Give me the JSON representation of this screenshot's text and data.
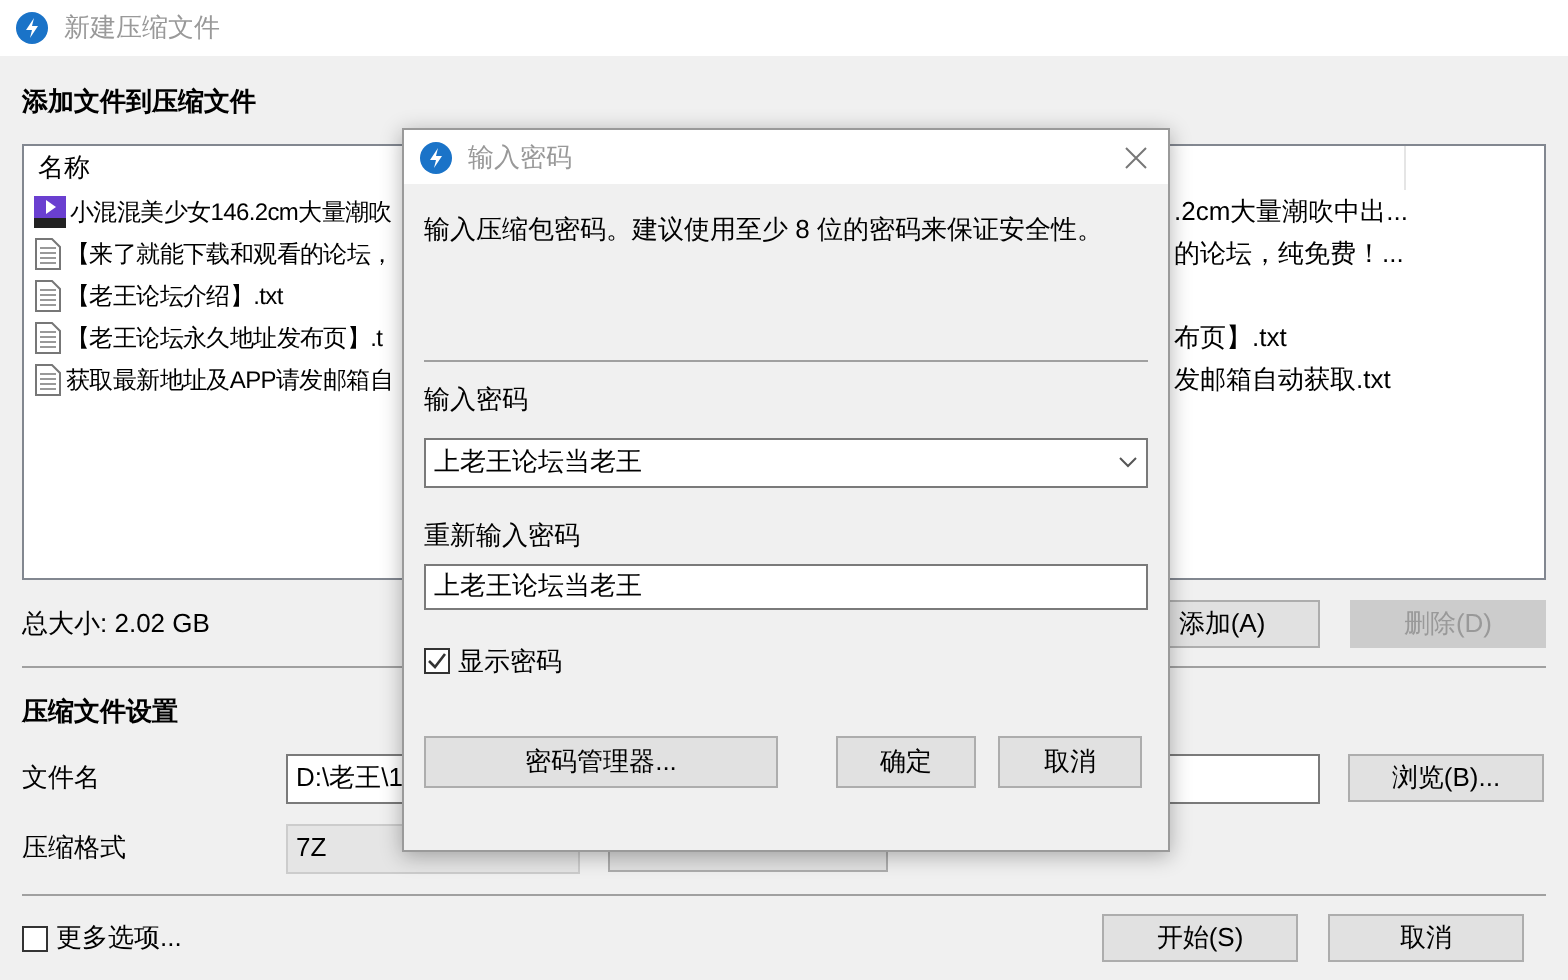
{
  "window": {
    "title": "新建压缩文件"
  },
  "add_section": {
    "heading": "添加文件到压缩文件",
    "column": "名称",
    "files": [
      {
        "kind": "video",
        "left": "小混混美少女146.2cm大量潮吹",
        "right": ".2cm大量潮吹中出..."
      },
      {
        "kind": "text",
        "left": "【来了就能下载和观看的论坛，",
        "right": "的论坛，纯免费！..."
      },
      {
        "kind": "text",
        "left": "【老王论坛介绍】.txt"
      },
      {
        "kind": "text",
        "left": "【老王论坛永久地址发布页】.t",
        "right": "布页】.txt"
      },
      {
        "kind": "text",
        "left": "获取最新地址及APP请发邮箱自",
        "right": "发邮箱自动获取.txt"
      }
    ],
    "total": "总大小: 2.02 GB",
    "buttons": [
      {
        "label": "添加(A)",
        "disabled": false
      },
      {
        "label": "删除(D)",
        "disabled": true
      }
    ]
  },
  "settings": {
    "heading": "压缩文件设置",
    "filename_label": "文件名",
    "filename_value": "D:\\老王\\1",
    "browse": "浏览(B)...",
    "format_label": "压缩格式",
    "format_value": "7Z"
  },
  "more_options": {
    "label": "更多选项...",
    "checked": false
  },
  "footer_buttons": [
    "开始(S)",
    "取消"
  ],
  "dialog": {
    "title": "输入密码",
    "message": "输入压缩包密码。建议使用至少 8 位的密码来保证安全性。",
    "password_label": "输入密码",
    "password_value": "上老王论坛当老王",
    "confirm_label": "重新输入密码",
    "confirm_value": "上老王论坛当老王",
    "show_password": {
      "label": "显示密码",
      "checked": true
    },
    "manager": "密码管理器...",
    "ok": "确定",
    "cancel": "取消"
  }
}
